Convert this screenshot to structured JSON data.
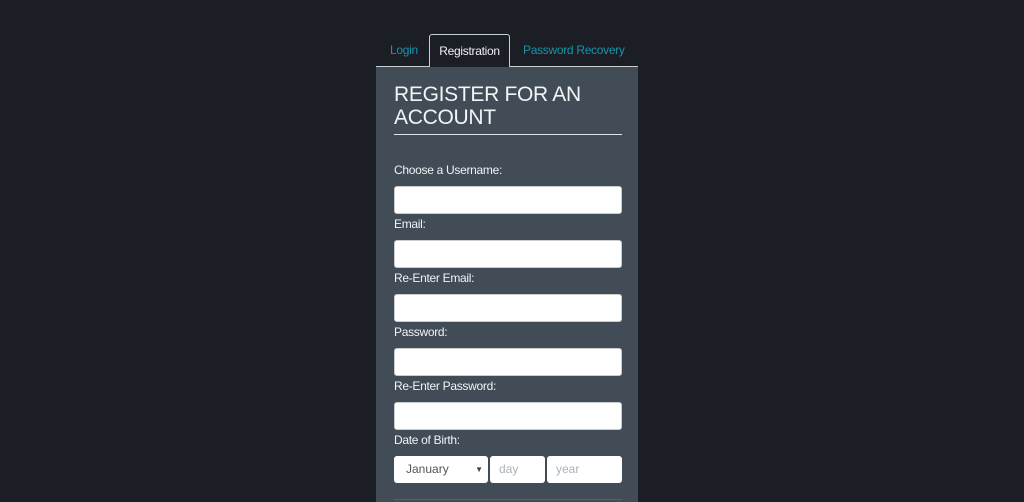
{
  "tabs": [
    {
      "label": "Login",
      "active": false
    },
    {
      "label": "Registration",
      "active": true
    },
    {
      "label": "Password Recovery",
      "active": false
    }
  ],
  "form": {
    "title": "REGISTER FOR AN ACCOUNT",
    "fields": [
      {
        "label": "Choose a Username:",
        "value": ""
      },
      {
        "label": "Email:",
        "value": ""
      },
      {
        "label": "Re-Enter Email:",
        "value": ""
      },
      {
        "label": "Password:",
        "value": ""
      },
      {
        "label": "Re-Enter Password:",
        "value": ""
      }
    ],
    "dob": {
      "label": "Date of Birth:",
      "month": "January",
      "day_placeholder": "day",
      "year_placeholder": "year"
    }
  },
  "colors": {
    "background": "#1b1e24",
    "panel": "#414c57",
    "link": "#1a93ab"
  }
}
